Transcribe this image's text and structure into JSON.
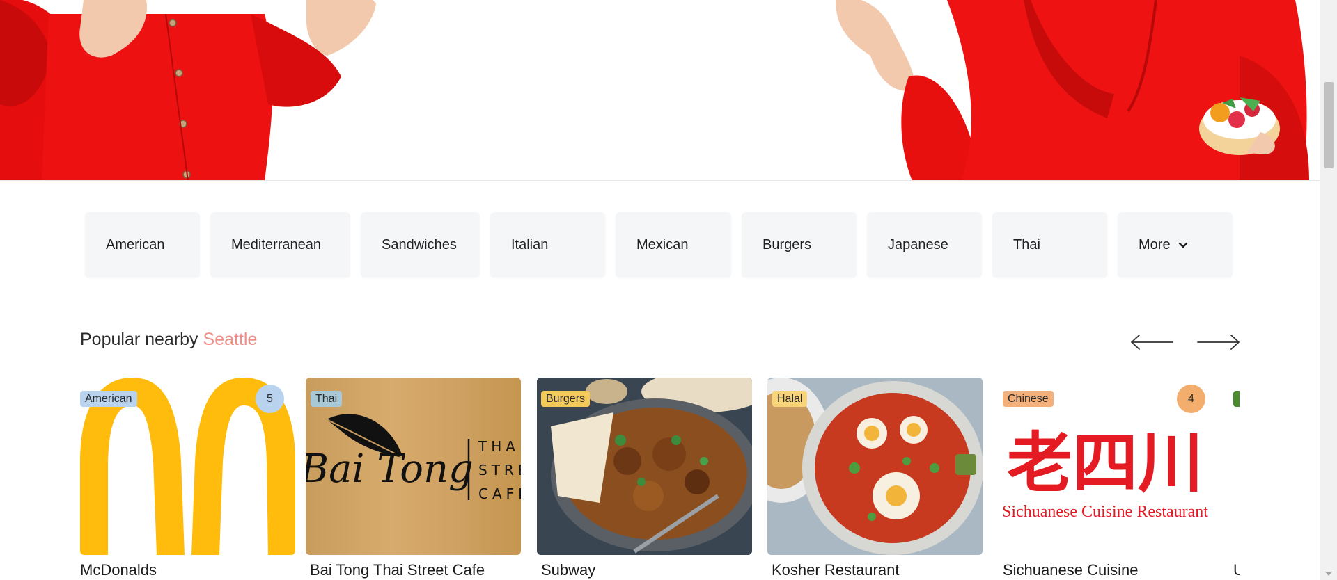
{
  "categories": [
    {
      "label": "American"
    },
    {
      "label": "Mediterranean"
    },
    {
      "label": "Sandwiches"
    },
    {
      "label": "Italian"
    },
    {
      "label": "Mexican"
    },
    {
      "label": "Burgers"
    },
    {
      "label": "Japanese"
    },
    {
      "label": "Thai"
    }
  ],
  "more": {
    "label": "More",
    "icon": "chevron-down-icon"
  },
  "popular": {
    "title": "Popular nearby",
    "city": "Seattle",
    "prev_icon": "arrow-left-icon",
    "next_icon": "arrow-right-icon"
  },
  "restaurants": [
    {
      "name": "McDonalds",
      "tag": "American",
      "count": "5",
      "tag_color": "#b9d3ee",
      "count_color": "#b9d3ee"
    },
    {
      "name": "Bai Tong Thai Street Cafe",
      "tag": "Thai",
      "logo_script": "Bai Tong",
      "logo_text": [
        "THAI",
        "STREET",
        "CAFE"
      ],
      "tag_color": "#a9c8d6"
    },
    {
      "name": "Subway",
      "tag": "Burgers",
      "tag_color": "#f3c959"
    },
    {
      "name": "Kosher Restaurant",
      "tag": "Halal",
      "tag_color": "#f7d37a"
    },
    {
      "name": "Sichuanese Cuisine",
      "tag": "Chinese",
      "count": "4",
      "logo_cn": "老四川",
      "logo_en": "Sichuanese Cuisine Restaurant",
      "tag_color": "#f3b07a",
      "count_color": "#f3ae6e"
    },
    {
      "name": "U",
      "tag_color": "#4b8a2e"
    }
  ]
}
